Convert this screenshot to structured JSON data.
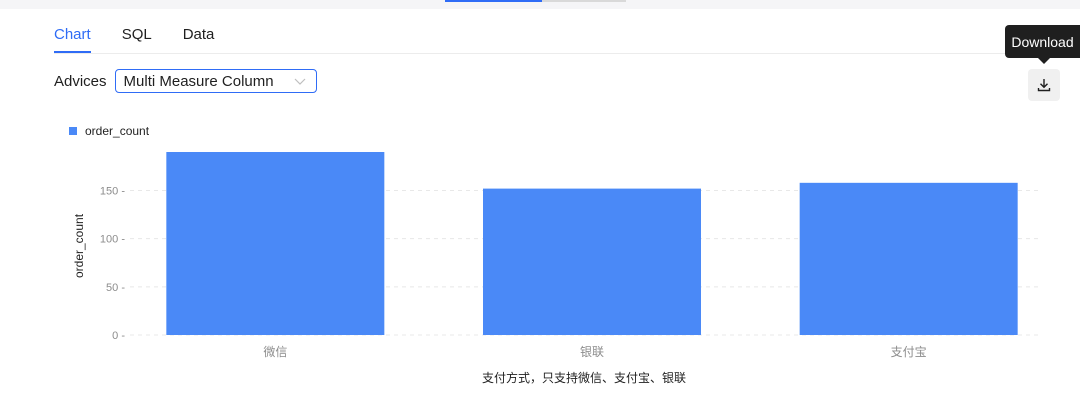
{
  "tabs": [
    {
      "label": "Chart",
      "active": true
    },
    {
      "label": "SQL",
      "active": false
    },
    {
      "label": "Data",
      "active": false
    }
  ],
  "advices": {
    "label": "Advices",
    "selected": "Multi Measure Column"
  },
  "toolbar": {
    "download_tooltip": "Download"
  },
  "colors": {
    "accent": "#2f6cf6",
    "bar": "#4a89f7"
  },
  "chart_data": {
    "type": "bar",
    "categories": [
      "微信",
      "银联",
      "支付宝"
    ],
    "series": [
      {
        "name": "order_count",
        "values": [
          190,
          152,
          158
        ]
      }
    ],
    "xlabel": "支付方式，只支持微信、支付宝、银联",
    "ylabel": "order_count",
    "ylim": [
      0,
      190
    ],
    "yticks": [
      0,
      50,
      100,
      150
    ],
    "grid": true,
    "legend": "top-left"
  }
}
